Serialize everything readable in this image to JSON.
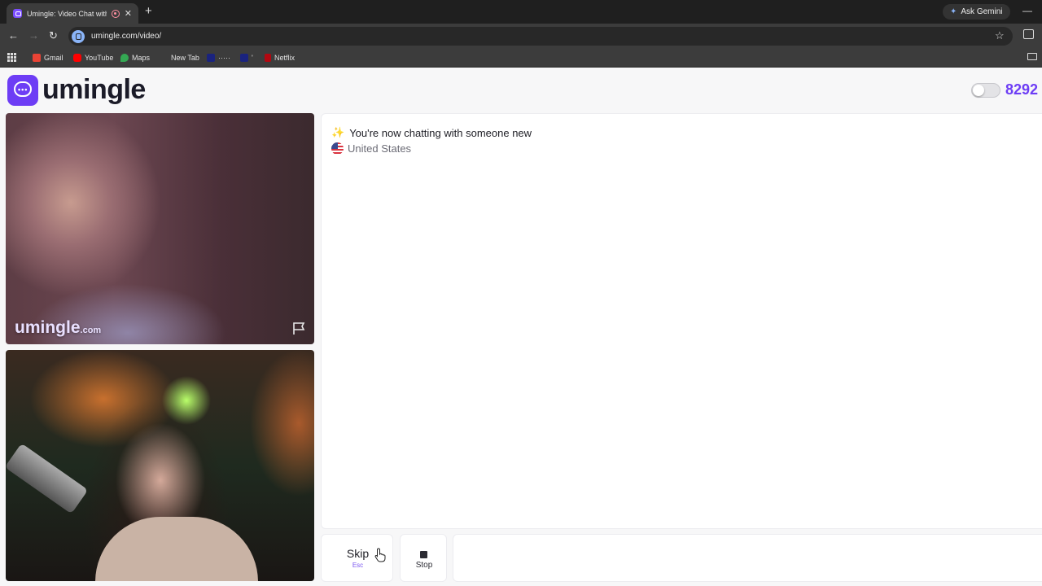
{
  "browser": {
    "tab_title": "Umingle: Video Chat with S",
    "new_tab": "+",
    "close": "✕",
    "ask_gemini": "Ask Gemini",
    "url": "umingle.com/video/",
    "bookmarks": [
      {
        "label": "Gmail",
        "color": "#ea4335"
      },
      {
        "label": "YouTube",
        "color": "#ff0000"
      },
      {
        "label": "Maps",
        "color": "#34a853"
      },
      {
        "label": "New Tab",
        "color": ""
      },
      {
        "label": "·····",
        "color": "#1a237e"
      },
      {
        "label": "'",
        "color": "#1a237e"
      },
      {
        "label": "Netflix",
        "color": "#b20710"
      }
    ]
  },
  "header": {
    "logo_text": "umingle",
    "online_count": "8292",
    "accent": "#6d3df5"
  },
  "video": {
    "watermark": "umingle",
    "watermark_suffix": ".com"
  },
  "chat": {
    "status": "You're now chatting with someone new",
    "country": "United States"
  },
  "controls": {
    "skip_label": "Skip",
    "skip_hint": "Esc",
    "stop_label": "Stop"
  }
}
